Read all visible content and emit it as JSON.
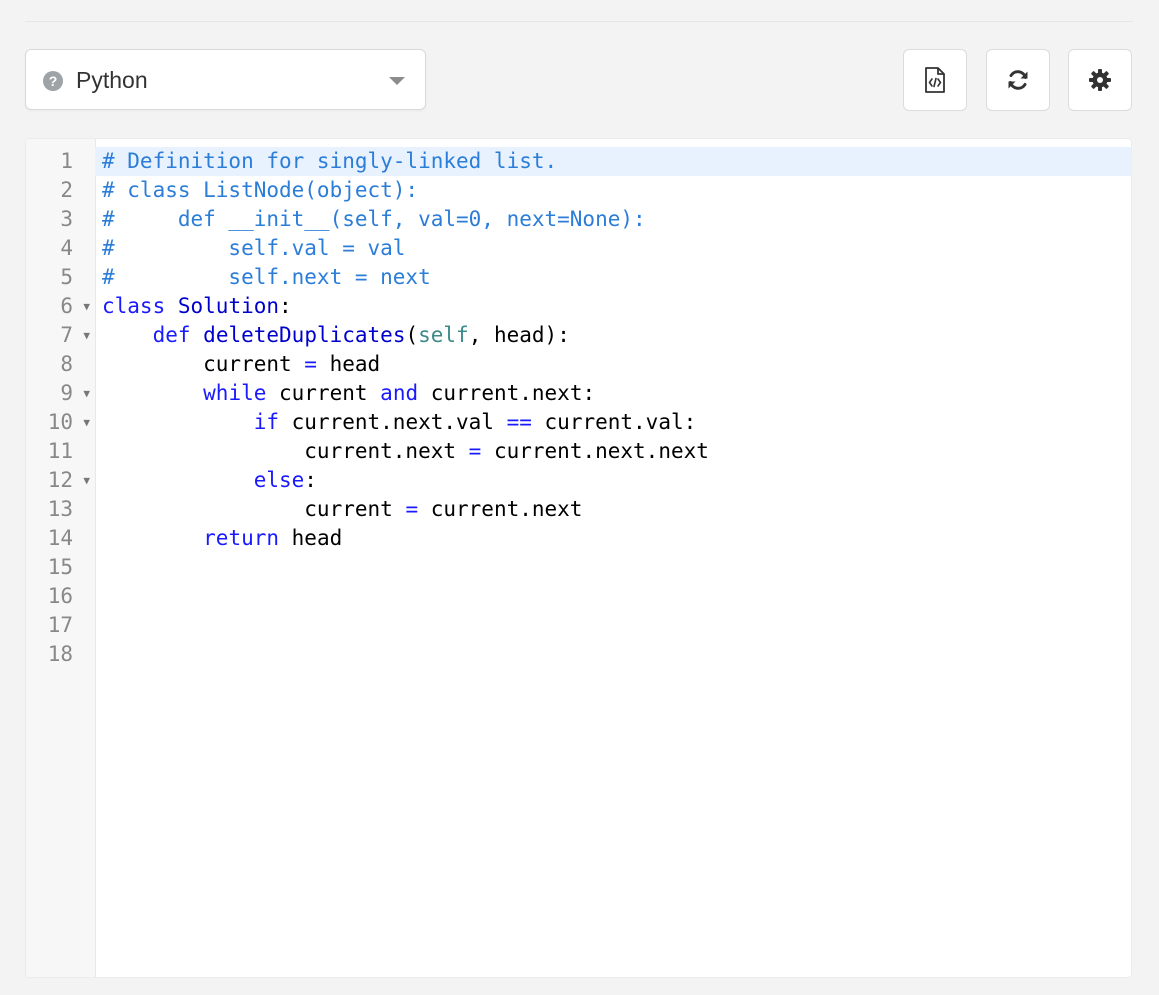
{
  "language_selector": {
    "selected": "Python",
    "help_icon": "question-circle-icon",
    "caret_icon": "caret-down-icon"
  },
  "toolbar": {
    "buttons": [
      {
        "name": "code-file-button",
        "icon": "code-file-icon"
      },
      {
        "name": "reset-button",
        "icon": "refresh-icon"
      },
      {
        "name": "settings-button",
        "icon": "gear-icon"
      }
    ]
  },
  "editor": {
    "active_line": 1,
    "colors": {
      "comment": "#2b7dd8",
      "keyword": "#1a1aff",
      "self": "#3d8a8a",
      "active_line_bg": "#e8f2fe"
    },
    "lines": [
      {
        "num": "1",
        "fold": false,
        "tokens": [
          {
            "t": "# Definition for singly-linked list.",
            "c": "comment"
          }
        ]
      },
      {
        "num": "2",
        "fold": false,
        "tokens": [
          {
            "t": "# class ListNode(object):",
            "c": "comment"
          }
        ]
      },
      {
        "num": "3",
        "fold": false,
        "tokens": [
          {
            "t": "#     def __init__(self, val=0, next=None):",
            "c": "comment"
          }
        ]
      },
      {
        "num": "4",
        "fold": false,
        "tokens": [
          {
            "t": "#         self.val = val",
            "c": "comment"
          }
        ]
      },
      {
        "num": "5",
        "fold": false,
        "tokens": [
          {
            "t": "#         self.next = next",
            "c": "comment"
          }
        ]
      },
      {
        "num": "6",
        "fold": true,
        "tokens": [
          {
            "t": "class",
            "c": "kw"
          },
          {
            "t": " ",
            "c": "plain"
          },
          {
            "t": "Solution",
            "c": "def"
          },
          {
            "t": ":",
            "c": "plain"
          }
        ]
      },
      {
        "num": "7",
        "fold": true,
        "tokens": [
          {
            "t": "    ",
            "c": "plain"
          },
          {
            "t": "def",
            "c": "kw"
          },
          {
            "t": " ",
            "c": "plain"
          },
          {
            "t": "deleteDuplicates",
            "c": "def"
          },
          {
            "t": "(",
            "c": "plain"
          },
          {
            "t": "self",
            "c": "self"
          },
          {
            "t": ", head):",
            "c": "plain"
          }
        ]
      },
      {
        "num": "8",
        "fold": false,
        "tokens": [
          {
            "t": "        current ",
            "c": "plain"
          },
          {
            "t": "=",
            "c": "op"
          },
          {
            "t": " head",
            "c": "plain"
          }
        ]
      },
      {
        "num": "9",
        "fold": true,
        "tokens": [
          {
            "t": "        ",
            "c": "plain"
          },
          {
            "t": "while",
            "c": "kw"
          },
          {
            "t": " current ",
            "c": "plain"
          },
          {
            "t": "and",
            "c": "kw"
          },
          {
            "t": " current.next:",
            "c": "plain"
          }
        ]
      },
      {
        "num": "10",
        "fold": true,
        "tokens": [
          {
            "t": "            ",
            "c": "plain"
          },
          {
            "t": "if",
            "c": "kw"
          },
          {
            "t": " current.next.val ",
            "c": "plain"
          },
          {
            "t": "==",
            "c": "op"
          },
          {
            "t": " current.val:",
            "c": "plain"
          }
        ]
      },
      {
        "num": "11",
        "fold": false,
        "tokens": [
          {
            "t": "                current.next ",
            "c": "plain"
          },
          {
            "t": "=",
            "c": "op"
          },
          {
            "t": " current.next.next",
            "c": "plain"
          }
        ]
      },
      {
        "num": "12",
        "fold": true,
        "tokens": [
          {
            "t": "            ",
            "c": "plain"
          },
          {
            "t": "else",
            "c": "kw"
          },
          {
            "t": ":",
            "c": "plain"
          }
        ]
      },
      {
        "num": "13",
        "fold": false,
        "tokens": [
          {
            "t": "                current ",
            "c": "plain"
          },
          {
            "t": "=",
            "c": "op"
          },
          {
            "t": " current.next",
            "c": "plain"
          }
        ]
      },
      {
        "num": "14",
        "fold": false,
        "tokens": [
          {
            "t": "        ",
            "c": "plain"
          },
          {
            "t": "return",
            "c": "kw"
          },
          {
            "t": " head",
            "c": "plain"
          }
        ]
      },
      {
        "num": "15",
        "fold": false,
        "tokens": []
      },
      {
        "num": "16",
        "fold": false,
        "tokens": []
      },
      {
        "num": "17",
        "fold": false,
        "tokens": []
      },
      {
        "num": "18",
        "fold": false,
        "tokens": []
      }
    ]
  }
}
